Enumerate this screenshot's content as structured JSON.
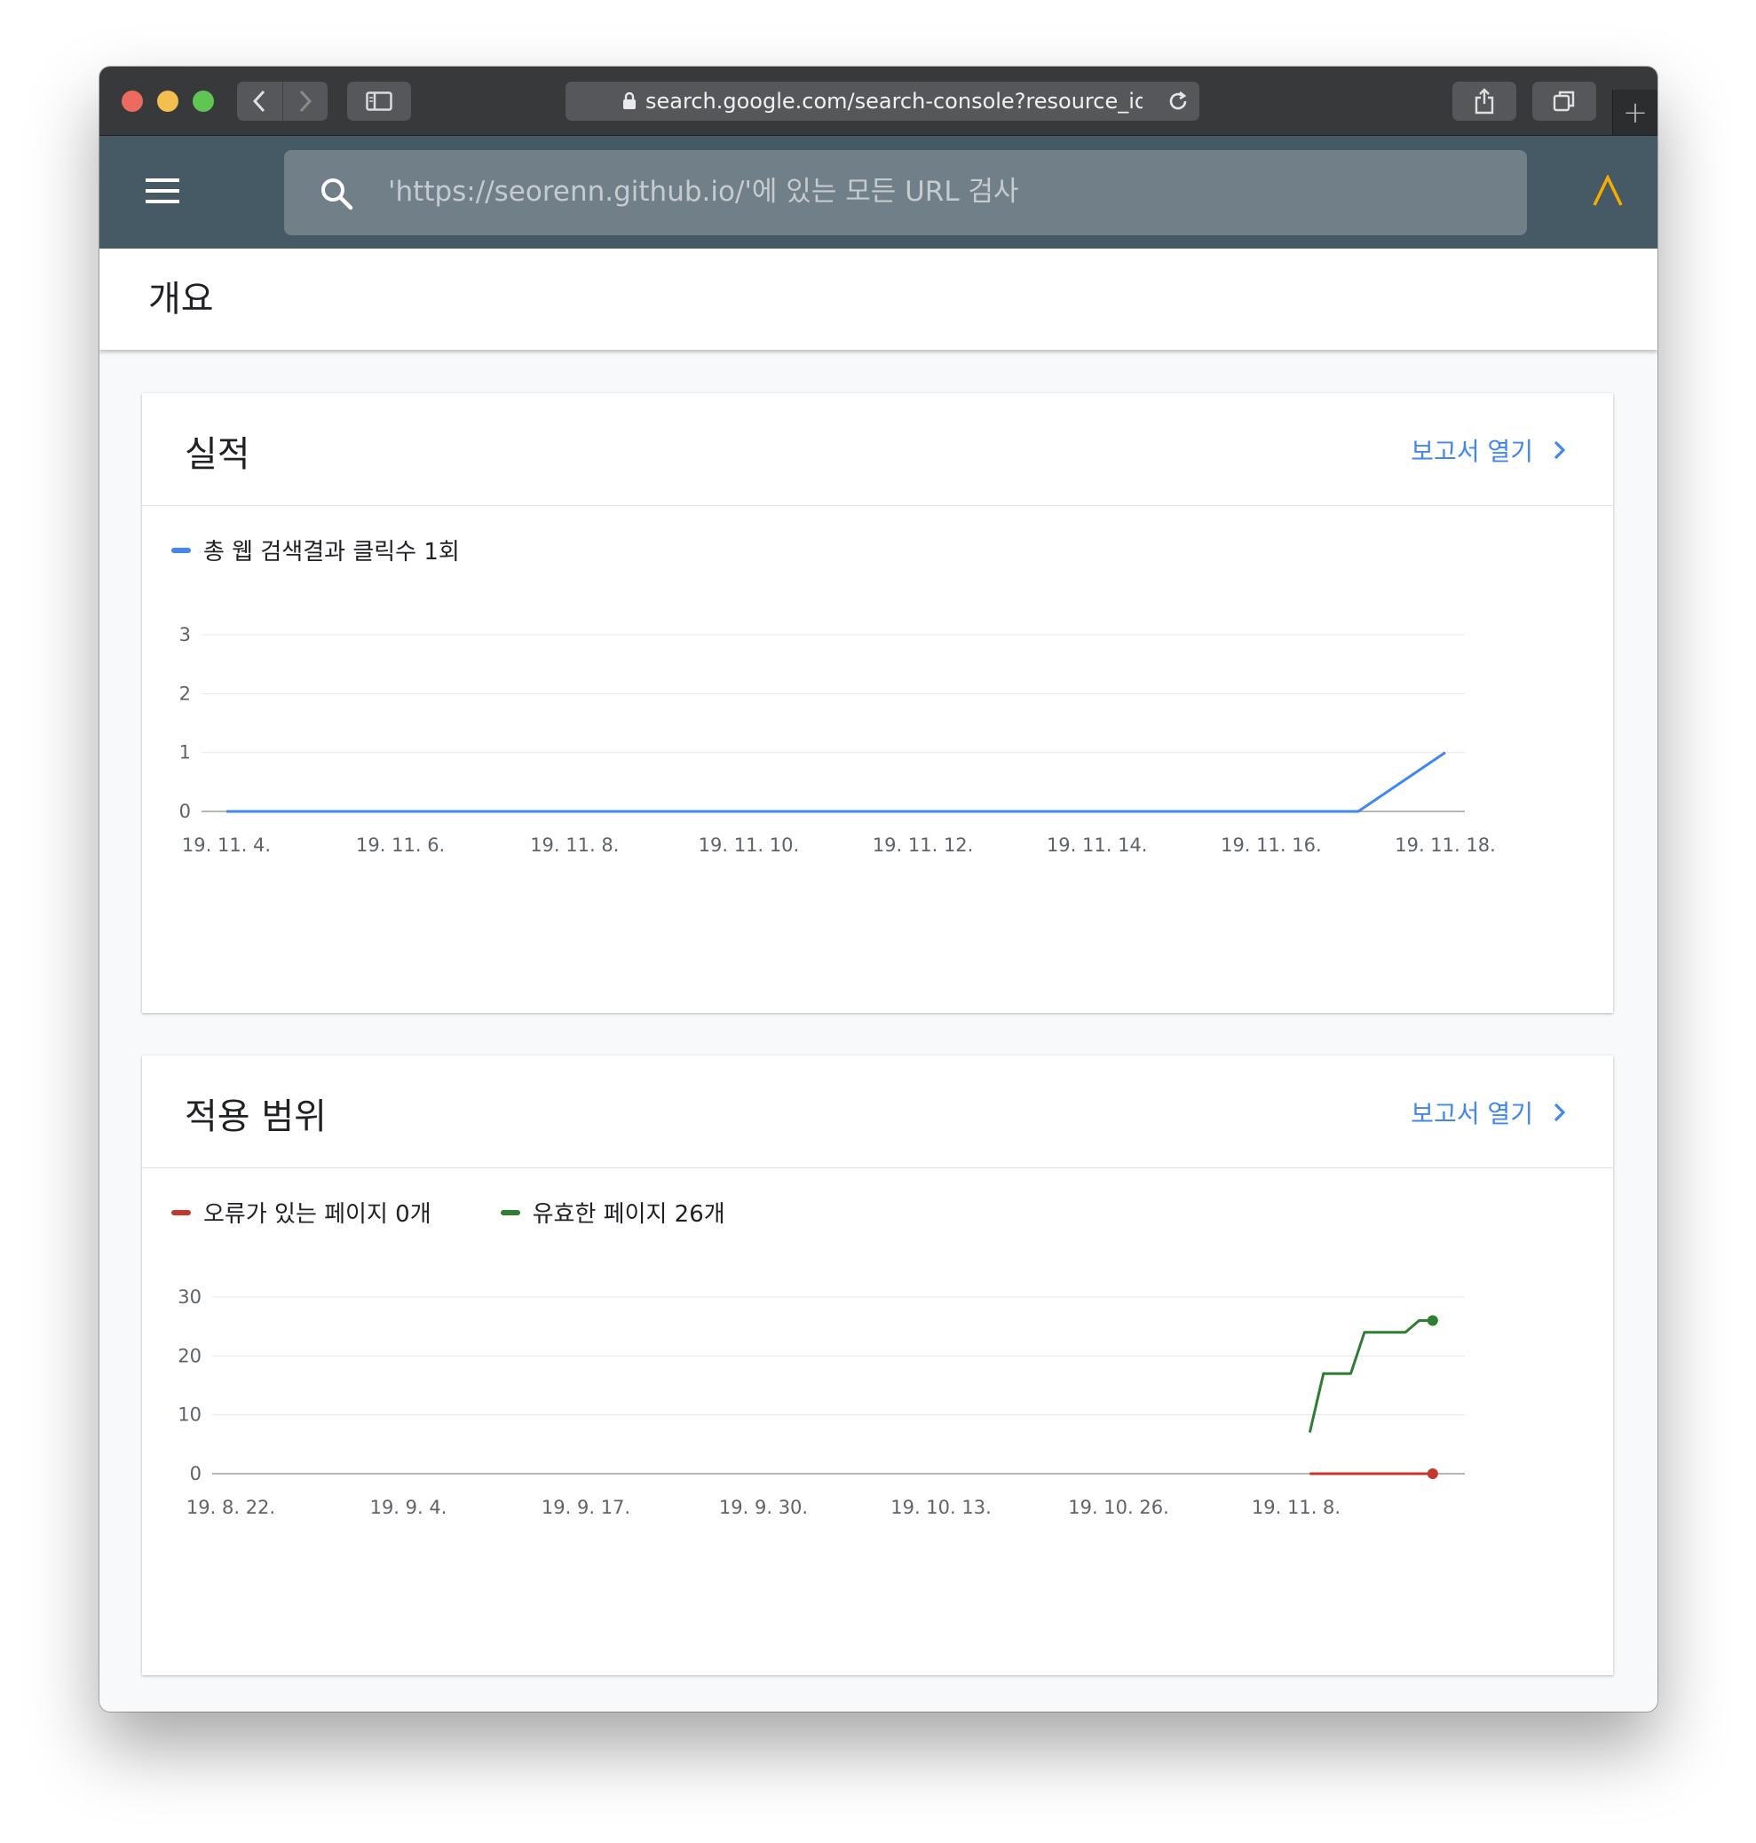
{
  "browser": {
    "url": "search.google.com/search-console?resource_id=",
    "new_tab_label": "+"
  },
  "search": {
    "placeholder": "'https://seorenn.github.io/'에 있는 모든 URL 검사"
  },
  "page": {
    "title": "개요"
  },
  "performance": {
    "title": "실적",
    "link_label": "보고서 열기",
    "legend": "총 웹 검색결과 클릭수 1회",
    "colors": {
      "clicks": "#4285f4"
    }
  },
  "coverage": {
    "title": "적용 범위",
    "link_label": "보고서 열기",
    "legend_errors": "오류가 있는 페이지 0개",
    "legend_valid": "유효한 페이지 26개",
    "colors": {
      "errors": "#c5372c",
      "valid": "#2e7d32"
    }
  },
  "chart_data": [
    {
      "type": "line",
      "title": "실적",
      "xlabel": "",
      "ylabel": "",
      "x_ticks": [
        "19. 11. 4.",
        "19. 11. 6.",
        "19. 11. 8.",
        "19. 11. 10.",
        "19. 11. 12.",
        "19. 11. 14.",
        "19. 11. 16.",
        "19. 11. 18."
      ],
      "x": [
        "2019-11-04",
        "2019-11-05",
        "2019-11-06",
        "2019-11-07",
        "2019-11-08",
        "2019-11-09",
        "2019-11-10",
        "2019-11-11",
        "2019-11-12",
        "2019-11-13",
        "2019-11-14",
        "2019-11-15",
        "2019-11-16",
        "2019-11-17",
        "2019-11-18"
      ],
      "y_ticks": [
        0,
        1,
        2,
        3
      ],
      "ylim": [
        0,
        3
      ],
      "grid": true,
      "legend_position": "top-left",
      "series": [
        {
          "name": "총 웹 검색결과 클릭수 1회",
          "color": "#4285f4",
          "values": [
            0,
            0,
            0,
            0,
            0,
            0,
            0,
            0,
            0,
            0,
            0,
            0,
            0,
            0,
            1
          ]
        }
      ]
    },
    {
      "type": "line",
      "title": "적용 범위",
      "xlabel": "",
      "ylabel": "",
      "x_ticks": [
        "19. 8. 22.",
        "19. 9. 4.",
        "19. 9. 17.",
        "19. 9. 30.",
        "19. 10. 13.",
        "19. 10. 26.",
        "19. 11. 8."
      ],
      "y_ticks": [
        0,
        10,
        20,
        30
      ],
      "ylim": [
        0,
        30
      ],
      "grid": true,
      "legend_position": "top-left",
      "series": [
        {
          "name": "오류가 있는 페이지 0개",
          "color": "#c5372c",
          "x": [
            "2019-11-09",
            "2019-11-17",
            "2019-11-18"
          ],
          "values": [
            0,
            0,
            0
          ]
        },
        {
          "name": "유효한 페이지 26개",
          "color": "#2e7d32",
          "x": [
            "2019-11-09",
            "2019-11-10",
            "2019-11-12",
            "2019-11-13",
            "2019-11-16",
            "2019-11-17",
            "2019-11-18"
          ],
          "values": [
            7,
            17,
            17,
            24,
            24,
            26,
            26
          ]
        }
      ]
    }
  ]
}
